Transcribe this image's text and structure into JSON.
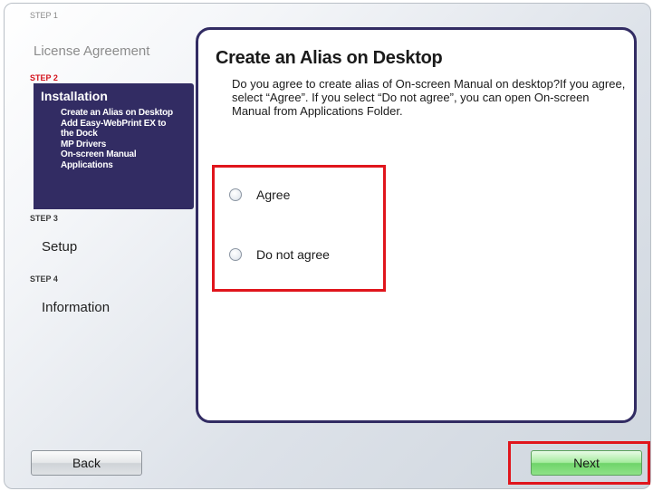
{
  "sidebar": {
    "step1": {
      "label": "STEP 1",
      "title": "License Agreement"
    },
    "step2": {
      "label": "STEP 2",
      "title": "Installation",
      "substeps": [
        "Create an Alias on Desktop",
        "Add Easy-WebPrint EX to",
        "the Dock",
        "MP Drivers",
        "On-screen Manual",
        "Applications"
      ]
    },
    "step3": {
      "label": "STEP 3",
      "title": "Setup"
    },
    "step4": {
      "label": "STEP 4",
      "title": "Information"
    }
  },
  "main": {
    "title": "Create an Alias on Desktop",
    "description": "Do you agree to create alias of On-screen Manual on desktop?If you agree, select “Agree”. If you select “Do not agree”, you can open On-screen Manual from Applications Folder.",
    "options": [
      {
        "label": "Agree",
        "selected": false
      },
      {
        "label": "Do not agree",
        "selected": false
      }
    ]
  },
  "buttons": {
    "back": "Back",
    "next": "Next"
  },
  "colors": {
    "panel": "#322c63",
    "highlight": "#e0151c",
    "current_step": "#d4121b"
  }
}
